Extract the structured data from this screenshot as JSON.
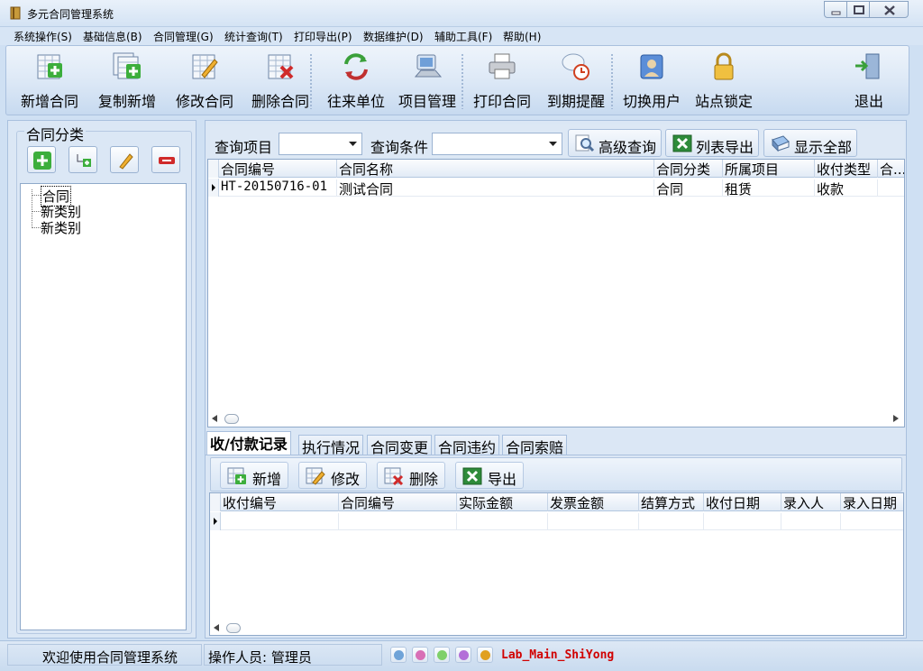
{
  "window": {
    "title": "多元合同管理系统"
  },
  "menu": [
    "系统操作(S)",
    "基础信息(B)",
    "合同管理(G)",
    "统计查询(T)",
    "打印导出(P)",
    "数据维护(D)",
    "辅助工具(F)",
    "帮助(H)"
  ],
  "toolbar": [
    {
      "label": "新增合同",
      "icon": "add-contract-icon"
    },
    {
      "label": "复制新增",
      "icon": "copy-new-icon"
    },
    {
      "label": "修改合同",
      "icon": "edit-contract-icon"
    },
    {
      "label": "删除合同",
      "icon": "delete-contract-icon"
    },
    {
      "label": "往来单位",
      "icon": "partners-icon"
    },
    {
      "label": "项目管理",
      "icon": "project-icon"
    },
    {
      "label": "打印合同",
      "icon": "printer-icon"
    },
    {
      "label": "到期提醒",
      "icon": "alarm-icon"
    },
    {
      "label": "切换用户",
      "icon": "switch-user-icon"
    },
    {
      "label": "站点锁定",
      "icon": "lock-icon"
    },
    {
      "label": "退出",
      "icon": "exit-icon"
    }
  ],
  "category_panel": {
    "title": "合同分类",
    "buttons": [
      "add-icon",
      "add-child-icon",
      "edit-icon",
      "remove-icon"
    ],
    "tree": [
      "合同",
      "新类别",
      "新类别"
    ]
  },
  "query": {
    "item_label": "查询项目",
    "item_value": "",
    "condition_label": "查询条件",
    "condition_value": "",
    "advanced_label": "高级查询",
    "export_label": "列表导出",
    "show_all_label": "显示全部"
  },
  "contracts_grid": {
    "columns": [
      "合同编号",
      "合同名称",
      "合同分类",
      "所属项目",
      "收付类型",
      "合..."
    ],
    "rows": [
      [
        "HT-20150716-01",
        "测试合同",
        "合同",
        "租赁",
        "收款",
        ""
      ]
    ]
  },
  "tabs": [
    "收/付款记录",
    "执行情况",
    "合同变更",
    "合同违约",
    "合同索赔"
  ],
  "active_tab": 0,
  "records_toolbar": {
    "add_label": "新增",
    "edit_label": "修改",
    "delete_label": "删除",
    "export_label": "导出"
  },
  "records_grid": {
    "columns": [
      "收付编号",
      "合同编号",
      "实际金额",
      "发票金额",
      "结算方式",
      "收付日期",
      "录入人",
      "录入日期"
    ],
    "rows": []
  },
  "status": {
    "welcome": "欢迎使用合同管理系统",
    "operator": "操作人员: 管理员",
    "lab": "Lab_Main_ShiYong",
    "theme_dots": [
      "#6fa3d8",
      "#d86fb6",
      "#7fd06a",
      "#b36fd8",
      "#e0a020"
    ]
  }
}
